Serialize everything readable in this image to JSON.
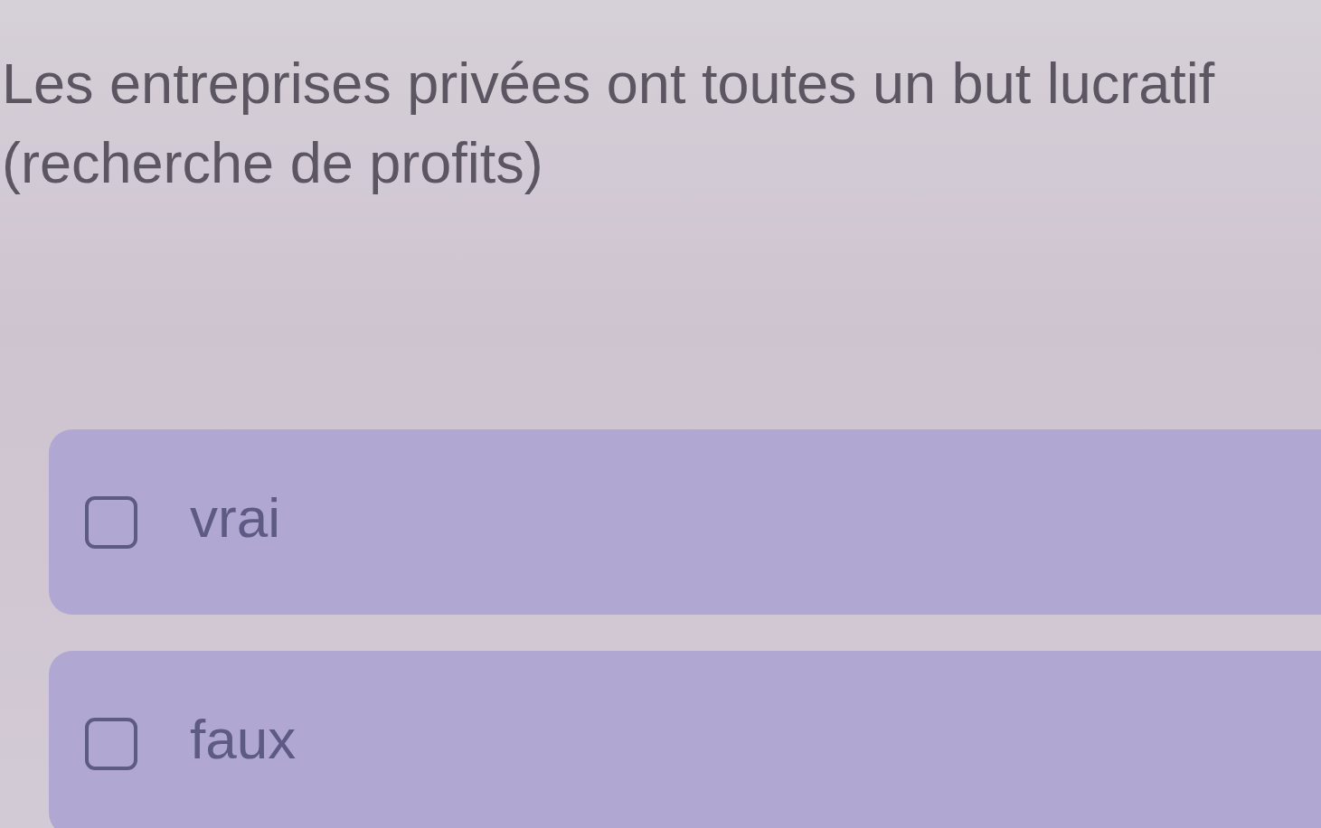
{
  "question": {
    "text": "Les entreprises privées ont toutes un but lucratif (recherche de profits)"
  },
  "options": [
    {
      "label": "vrai",
      "checked": false
    },
    {
      "label": "faux",
      "checked": false
    }
  ]
}
